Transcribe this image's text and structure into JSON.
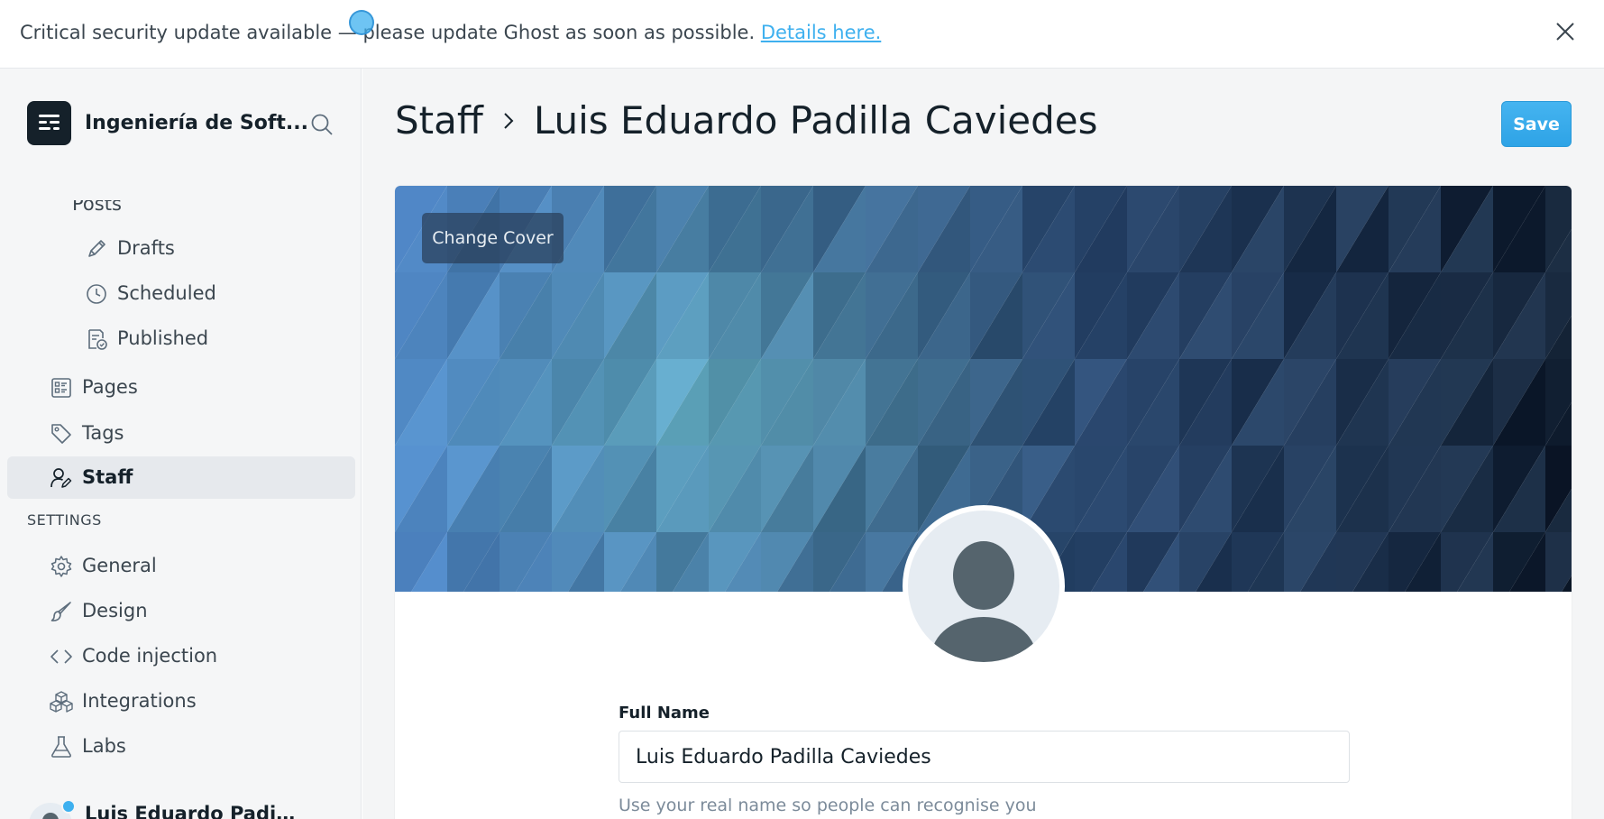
{
  "banner": {
    "text": "Critical security update available — please update Ghost as soon as possible. ",
    "link_label": "Details here."
  },
  "sidebar": {
    "brand_name": "Ingeniería de Soft...",
    "posts_partial_label": "Posts",
    "sub_items": [
      {
        "label": "Drafts",
        "icon": "pencil-icon"
      },
      {
        "label": "Scheduled",
        "icon": "clock-icon"
      },
      {
        "label": "Published",
        "icon": "published-icon"
      }
    ],
    "top_items": [
      {
        "label": "Pages",
        "icon": "pages-icon"
      },
      {
        "label": "Tags",
        "icon": "tag-icon"
      },
      {
        "label": "Staff",
        "icon": "staff-icon",
        "active": true
      }
    ],
    "settings_heading": "SETTINGS",
    "settings_items": [
      {
        "label": "General",
        "icon": "gear-icon"
      },
      {
        "label": "Design",
        "icon": "brush-icon"
      },
      {
        "label": "Code injection",
        "icon": "code-icon"
      },
      {
        "label": "Integrations",
        "icon": "integrations-icon"
      },
      {
        "label": "Labs",
        "icon": "flask-icon"
      }
    ],
    "user_name": "Luis Eduardo Padilla C..."
  },
  "header": {
    "breadcrumb_root": "Staff",
    "title": "Luis Eduardo Padilla Caviedes",
    "save_label": "Save"
  },
  "profile": {
    "change_cover_label": "Change Cover",
    "full_name_label": "Full Name",
    "full_name_value": "Luis Eduardo Padilla Caviedes",
    "full_name_hint": "Use your real name so people can recognise you"
  },
  "colors": {
    "accent": "#3eb0ef",
    "text": "#15212a",
    "sidebar_bg": "#f5f6f7",
    "active_bg": "#e6e9ed"
  }
}
